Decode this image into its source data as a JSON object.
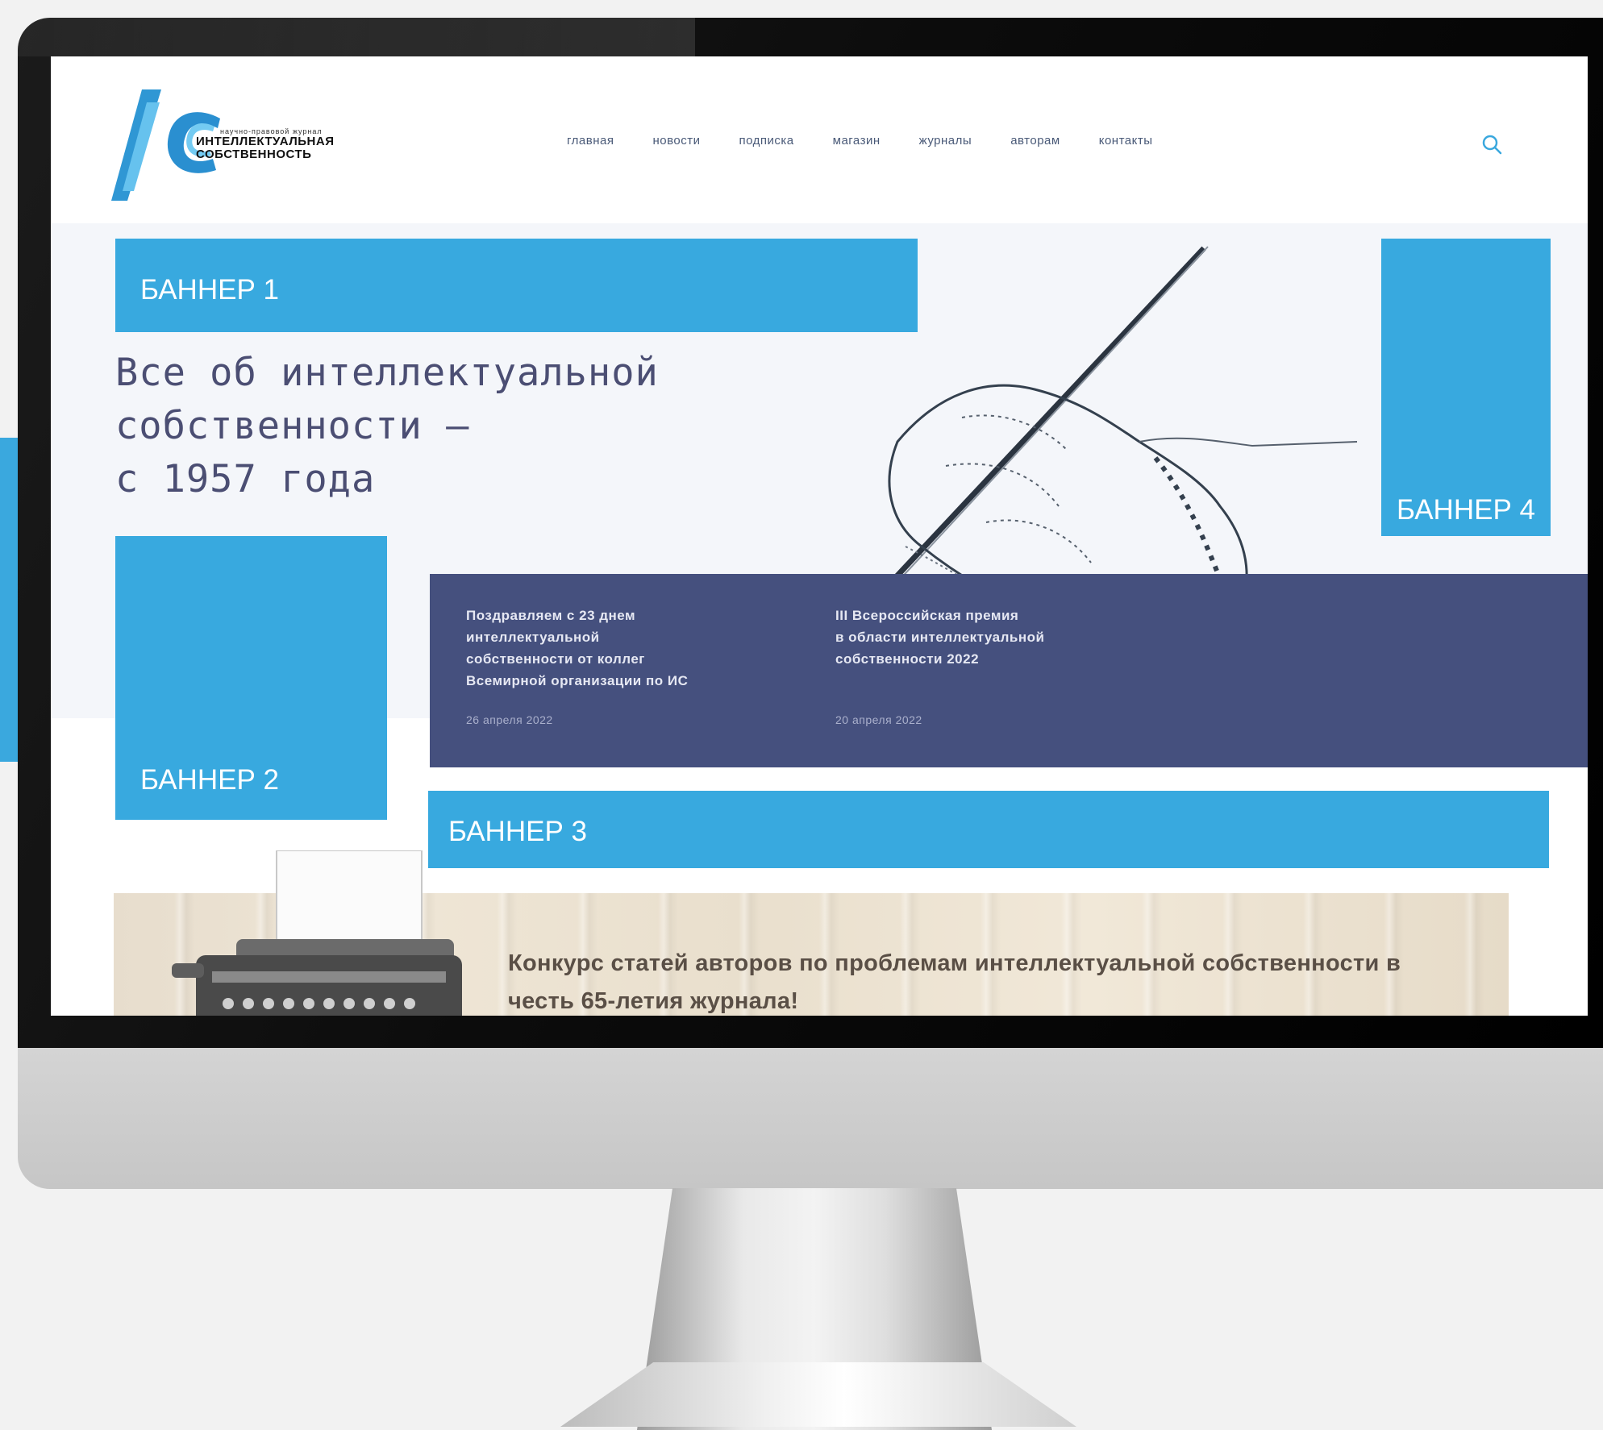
{
  "logo": {
    "small_caption": "научно-правовой журнал",
    "line1": "ИНТЕЛЛЕКТУАЛЬНАЯ",
    "line2": "СОБСТВЕННОСТЬ",
    "brand_color": "#3aa8de"
  },
  "nav": {
    "items": [
      "главная",
      "новости",
      "подписка",
      "магазин",
      "журналы",
      "авторам",
      "контакты"
    ]
  },
  "search": {
    "icon": "search-icon"
  },
  "banners": {
    "b1": "БАННЕР 1",
    "b2": "БАННЕР 2",
    "b3": "БАННЕР 3",
    "b4": "БАННЕР 4",
    "color": "#38a9df"
  },
  "hero": {
    "title_line1": "Все об интеллектуальной",
    "title_line2": "собственности –",
    "title_line3": "с 1957 года"
  },
  "news": {
    "item1": {
      "line1": "Поздравляем с 23 днем",
      "line2": "интеллектуальной",
      "line3": "собственности от коллег",
      "line4": "Всемирной организации по ИС",
      "date": "26 апреля 2022"
    },
    "item2": {
      "line1": "III Всероссийская премия",
      "line2": "в области интеллектуальной",
      "line3": "собственности 2022",
      "date": "20 апреля 2022"
    },
    "bg_color": "#45507e"
  },
  "promo": {
    "text_line1": "Конкурс статей авторов по проблемам интеллектуальной собственности в",
    "text_line2": "честь 65-летия журнала!"
  }
}
